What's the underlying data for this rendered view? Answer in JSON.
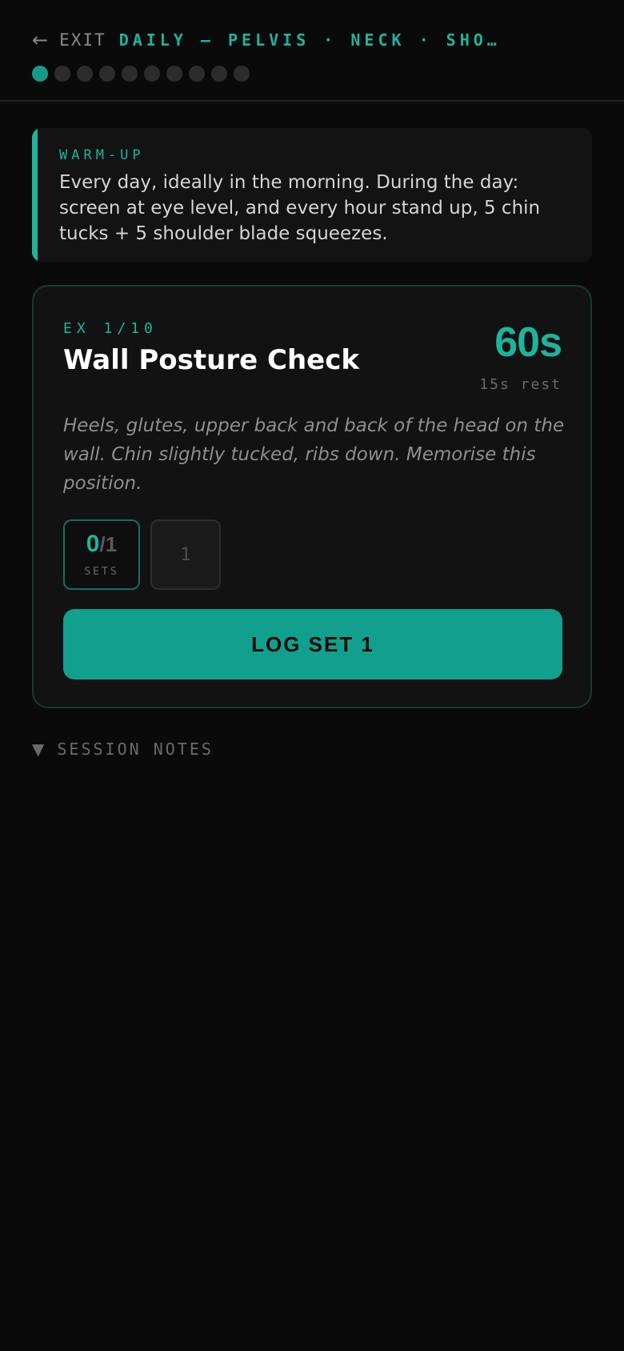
{
  "header": {
    "back_icon": "←",
    "exit_label": "EXIT",
    "workout_title": "DAILY — PELVIS · NECK · SHO…",
    "progress": {
      "total": 10,
      "current": 1
    }
  },
  "warmup": {
    "label": "WARM-UP",
    "text": "Every day, ideally in the morning. During the day: screen at eye level, and every hour stand up, 5 chin tucks + 5 shoulder blade squeezes."
  },
  "exercise": {
    "counter": "EX 1/10",
    "name": "Wall Posture Check",
    "duration": "60s",
    "rest": "15s rest",
    "description": "Heels, glutes, upper back and back of the head on the wall. Chin slightly tucked, ribs down. Memorise this position.",
    "sets": {
      "done": "0",
      "separator": "/",
      "total": "1",
      "label": "SETS",
      "slots": [
        "1"
      ]
    },
    "log_button": "LOG SET 1"
  },
  "notes": {
    "toggle_icon": "▼",
    "label": "SESSION NOTES"
  },
  "colors": {
    "accent": "#1fb39c",
    "button": "#12a08e",
    "background": "#0a0a0a",
    "card": "#121212"
  }
}
